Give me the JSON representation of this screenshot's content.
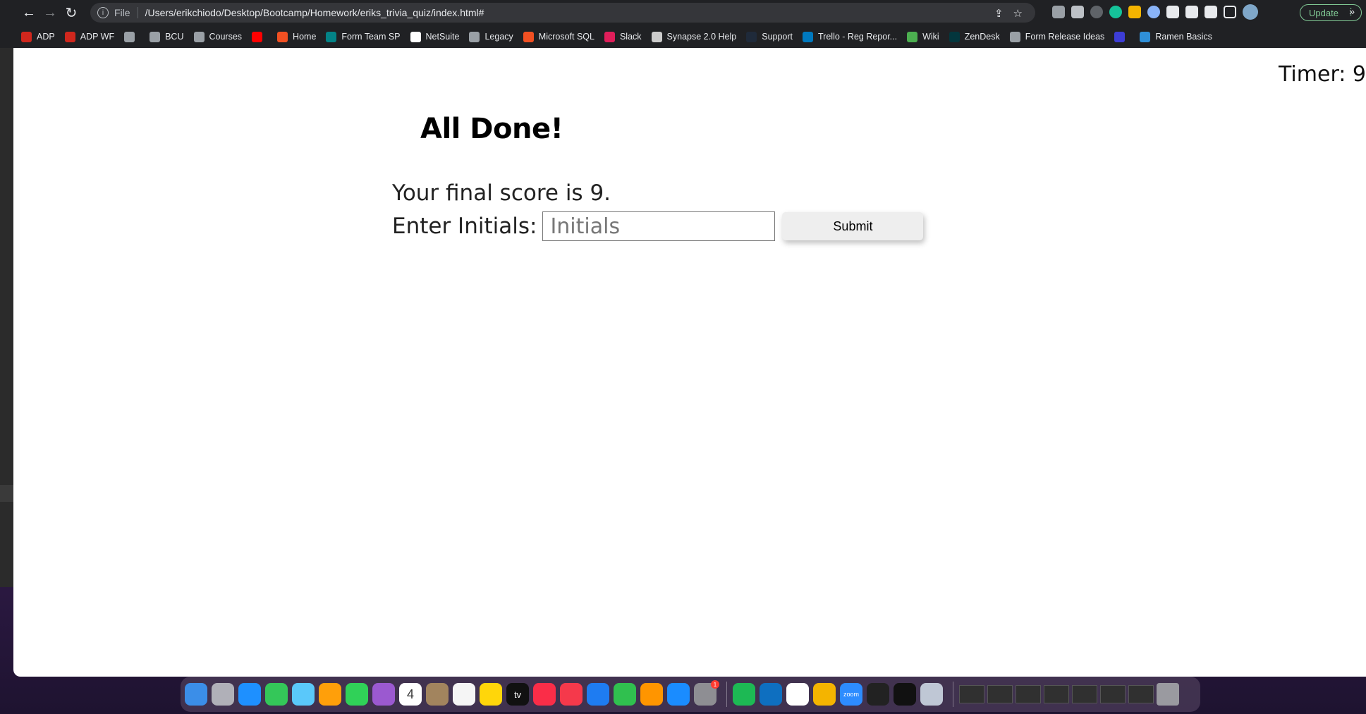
{
  "browser": {
    "scheme_label": "File",
    "url": "/Users/erikchiodo/Desktop/Bootcamp/Homework/eriks_trivia_quiz/index.html#",
    "back_icon": "←",
    "forward_icon": "→",
    "reload_icon": "↻",
    "share_icon": "⇪",
    "star_icon": "☆",
    "update_label": "Update",
    "menu_icon": "⋮",
    "bookmarks_more": "»",
    "bookmarks": [
      {
        "label": "ADP",
        "color": "#d0271d"
      },
      {
        "label": "ADP WF",
        "color": "#d0271d"
      },
      {
        "label": "",
        "color": "#9aa0a6"
      },
      {
        "label": "BCU",
        "color": "#9aa0a6"
      },
      {
        "label": "Courses",
        "color": "#9aa0a6"
      },
      {
        "label": "",
        "color": "#ff0000"
      },
      {
        "label": "Home",
        "color": "#f25022"
      },
      {
        "label": "Form Team SP",
        "color": "#038387"
      },
      {
        "label": "NetSuite",
        "color": "#ffffff"
      },
      {
        "label": "Legacy",
        "color": "#9aa0a6"
      },
      {
        "label": "Microsoft SQL",
        "color": "#f25022"
      },
      {
        "label": "Slack",
        "color": "#e01e5a"
      },
      {
        "label": "Synapse 2.0 Help",
        "color": "#cccccc"
      },
      {
        "label": "Support",
        "color": "#1f2a3a"
      },
      {
        "label": "Trello - Reg Repor...",
        "color": "#0079bf"
      },
      {
        "label": "Wiki",
        "color": "#4caf50"
      },
      {
        "label": "ZenDesk",
        "color": "#03363d"
      },
      {
        "label": "Form Release Ideas",
        "color": "#9aa0a6"
      },
      {
        "label": "",
        "color": "#3d3dd6"
      },
      {
        "label": "Ramen Basics",
        "color": "#2f8fd8"
      }
    ]
  },
  "quiz": {
    "timer": "Timer: 9",
    "heading": "All Done!",
    "final_score": "Your final score is 9.",
    "initials_label": "Enter Initials:",
    "initials_placeholder": "Initials",
    "submit_label": "Submit"
  },
  "dock": {
    "apps": [
      {
        "name": "finder",
        "color": "#3b8ee8"
      },
      {
        "name": "launchpad",
        "color": "#b0b0b8"
      },
      {
        "name": "safari",
        "color": "#1e90ff"
      },
      {
        "name": "messages",
        "color": "#34c759"
      },
      {
        "name": "maps",
        "color": "#5ac8fa"
      },
      {
        "name": "photos",
        "color": "#ff9f0a"
      },
      {
        "name": "facetime",
        "color": "#30d158"
      },
      {
        "name": "podcasts",
        "color": "#9b59d0"
      },
      {
        "name": "calendar",
        "color": "#ffffff"
      },
      {
        "name": "contacts",
        "color": "#a2845e"
      },
      {
        "name": "reminders",
        "color": "#f5f5f5"
      },
      {
        "name": "notes",
        "color": "#ffd60a"
      },
      {
        "name": "tv",
        "color": "#111111"
      },
      {
        "name": "music",
        "color": "#fa2d48"
      },
      {
        "name": "news",
        "color": "#f5394b"
      },
      {
        "name": "keynote",
        "color": "#1e7cf2"
      },
      {
        "name": "numbers",
        "color": "#30c04f"
      },
      {
        "name": "pages",
        "color": "#ff9500"
      },
      {
        "name": "app-store",
        "color": "#1a8cff"
      },
      {
        "name": "system-preferences",
        "color": "#8e8e93"
      }
    ],
    "apps2": [
      {
        "name": "spotify",
        "color": "#1db954"
      },
      {
        "name": "vscode",
        "color": "#0e6fc0"
      },
      {
        "name": "slack",
        "color": "#ffffff"
      },
      {
        "name": "chrome",
        "color": "#f4b400"
      },
      {
        "name": "zoom",
        "color": "#2d8cff"
      },
      {
        "name": "activity-monitor",
        "color": "#222222"
      },
      {
        "name": "terminal",
        "color": "#111111"
      },
      {
        "name": "preview",
        "color": "#bfc7d5"
      }
    ],
    "calendar_day": "4",
    "tv_label": "tv",
    "zoom_label": "zoom",
    "sysprefs_badge": "1"
  }
}
